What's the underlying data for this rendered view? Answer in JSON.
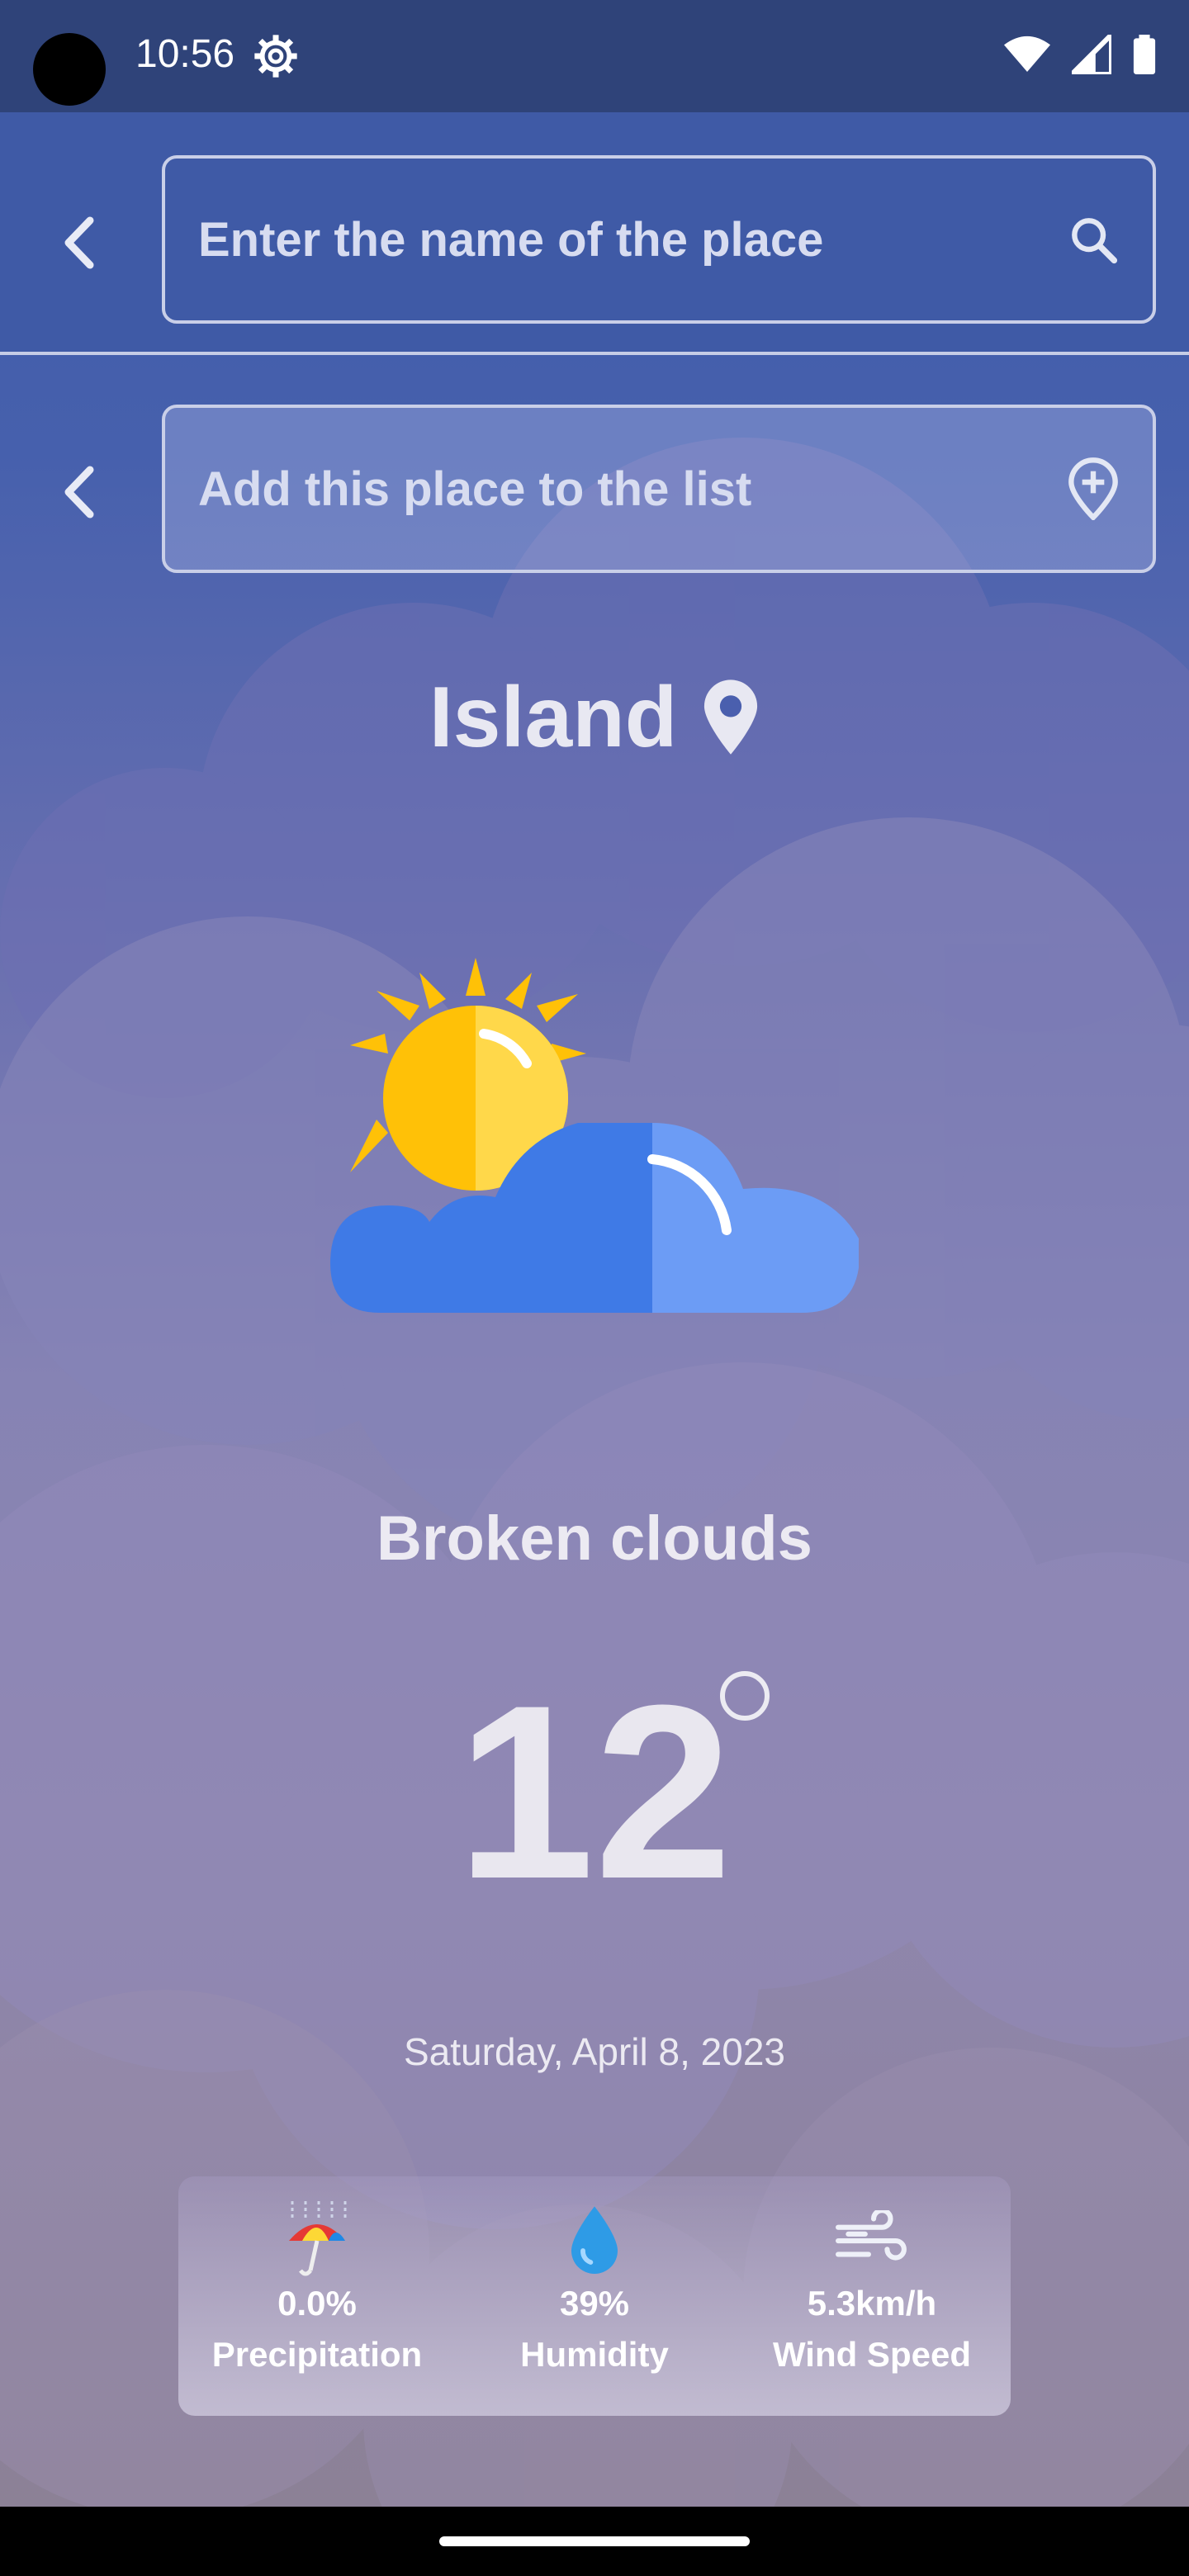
{
  "status_bar": {
    "time": "10:56",
    "icons": [
      "settings-gear-icon",
      "wifi-icon",
      "signal-icon",
      "battery-icon"
    ]
  },
  "search": {
    "placeholder": "Enter the name of the place",
    "icon": "search-icon"
  },
  "add_place": {
    "label": "Add this place to the list",
    "icon": "add-location-icon"
  },
  "location": {
    "name": "Island",
    "icon": "location-pin-icon"
  },
  "weather": {
    "icon": "sun-behind-cloud-icon",
    "description": "Broken clouds",
    "temperature": "12",
    "date": "Saturday, April 8, 2023"
  },
  "stats": [
    {
      "icon": "umbrella-rain-icon",
      "value": "0.0%",
      "label": "Precipitation"
    },
    {
      "icon": "water-drop-icon",
      "value": "39%",
      "label": "Humidity"
    },
    {
      "icon": "wind-icon",
      "value": "5.3km/h",
      "label": "Wind Speed"
    }
  ],
  "colors": {
    "status_bar": "#2f4379",
    "header": "#3f5aa6",
    "sun": "#ffc107",
    "cloud": "#3f7ae6",
    "cloud_light": "#6c9cf5"
  }
}
